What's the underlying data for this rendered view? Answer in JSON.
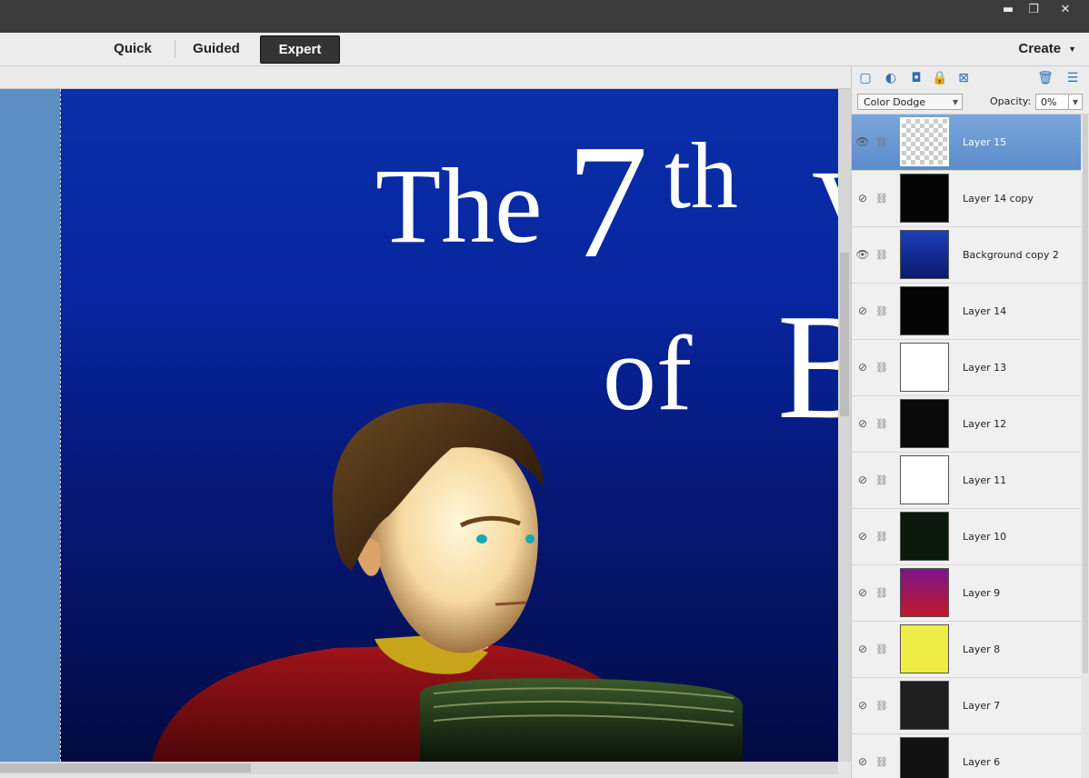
{
  "window": {
    "controls": {
      "minimize": "▬",
      "restore": "❐",
      "close": "✕"
    }
  },
  "modebar": {
    "tabs": [
      {
        "label": "Quick",
        "active": false
      },
      {
        "label": "Guided",
        "active": false
      },
      {
        "label": "Expert",
        "active": true
      }
    ],
    "create_label": "Create"
  },
  "canvas": {
    "art": {
      "the": "The",
      "seven": "7",
      "th": "th",
      "v": "V",
      "of": "of",
      "b": "B"
    }
  },
  "layers_panel": {
    "blend_mode": "Color Dodge",
    "opacity_label": "Opacity:",
    "opacity_value": "0%",
    "layers": [
      {
        "name": "Layer 15",
        "visible": true,
        "selected": true,
        "thumb": "checker"
      },
      {
        "name": "Layer 14 copy",
        "visible": false,
        "selected": false,
        "thumb": "black"
      },
      {
        "name": "Background copy 2",
        "visible": true,
        "selected": false,
        "thumb": "blue"
      },
      {
        "name": "Layer 14",
        "visible": false,
        "selected": false,
        "thumb": "black"
      },
      {
        "name": "Layer 13",
        "visible": false,
        "selected": false,
        "thumb": "white"
      },
      {
        "name": "Layer 12",
        "visible": false,
        "selected": false,
        "thumb": "dark"
      },
      {
        "name": "Layer 11",
        "visible": false,
        "selected": false,
        "thumb": "white"
      },
      {
        "name": "Layer 10",
        "visible": false,
        "selected": false,
        "thumb": "green"
      },
      {
        "name": "Layer 9",
        "visible": false,
        "selected": false,
        "thumb": "magenta"
      },
      {
        "name": "Layer 8",
        "visible": false,
        "selected": false,
        "thumb": "yellow"
      },
      {
        "name": "Layer 7",
        "visible": false,
        "selected": false,
        "thumb": "gray"
      },
      {
        "name": "Layer 6",
        "visible": false,
        "selected": false,
        "thumb": "smallblk"
      }
    ]
  },
  "icons": {
    "new-layer-icon": "▢",
    "adjustment-layer-icon": "◐",
    "layer-mask-icon": "◘",
    "lock-all-icon": "🔒",
    "lock-transparent-icon": "⊠",
    "trash-icon": "🗑",
    "panel-menu-icon": "☰",
    "eye-visible-icon": "👁",
    "eye-hidden-icon": "⊘",
    "link-icon": "⛓"
  }
}
